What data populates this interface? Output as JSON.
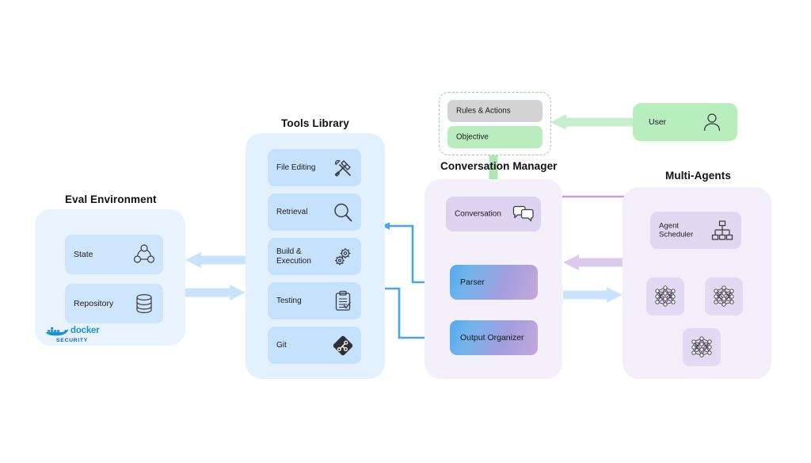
{
  "sections": {
    "eval_environment": {
      "title": "Eval Environment",
      "cards": [
        {
          "label": "State",
          "icon": "state-graph-icon"
        },
        {
          "label": "Repository",
          "icon": "database-icon"
        }
      ],
      "logo": {
        "name": "docker-security-logo",
        "word": "docker",
        "sub": "SECURITY"
      },
      "color": "#e8f3fd"
    },
    "tools_library": {
      "title": "Tools Library",
      "color": "#e3f0fd",
      "tools": [
        {
          "label": "File Editing",
          "icon": "hammer-wrench-icon"
        },
        {
          "label": "Retrieval",
          "icon": "magnifier-icon"
        },
        {
          "label": "Build & Execution",
          "icon": "gears-icon"
        },
        {
          "label": "Testing",
          "icon": "clipboard-checklist-icon"
        },
        {
          "label": "Git",
          "icon": "git-icon"
        }
      ]
    },
    "objective_group": {
      "cards": [
        {
          "label": "Rules & Actions",
          "color": "#d3d3d3"
        },
        {
          "label": "Objective",
          "color": "#b9ecbe"
        }
      ],
      "border_color": "#8fd79a"
    },
    "user": {
      "label": "User",
      "icon": "person-icon",
      "color": "#b8edbe"
    },
    "conversation_manager": {
      "title": "Conversation Manager",
      "color": "#f4f0fb",
      "conversation": {
        "label": "Conversation",
        "icon": "chat-bubbles-icon"
      },
      "parser": {
        "label": "Parser"
      },
      "output_organizer": {
        "label": "Output Organizer"
      }
    },
    "multi_agents": {
      "title": "Multi-Agents",
      "color": "#f2eefa",
      "scheduler": {
        "label": "Agent\nScheduler",
        "label_line1": "Agent",
        "label_line2": "Scheduler",
        "icon": "org-chart-icon"
      },
      "agents": [
        {
          "icon": "neural-network-icon"
        },
        {
          "icon": "neural-network-icon"
        },
        {
          "icon": "neural-network-icon"
        }
      ]
    }
  },
  "colors": {
    "blue_arrow": "#bfdffb",
    "purple_arrow": "#cdb6e4",
    "purple_arrow_light": "#dccaee",
    "green_arrow": "#c6efcd",
    "panel_blue": "#e8f3fd",
    "panel_purple": "#f4f0fb",
    "card_blue": "#c6e1fb",
    "icon_stroke": "#3b3b44"
  },
  "arrows": [
    {
      "name": "user-to-objective",
      "color": "#c6efcd",
      "from": "User",
      "to": "Rules & Actions"
    },
    {
      "name": "objective-to-conversation",
      "color": "#a9e5b4",
      "from": "Objective group",
      "to": "Conversation"
    },
    {
      "name": "eval-to-tools",
      "color": "#bfdffb",
      "from": "Tools Library",
      "to": "Eval Environment"
    },
    {
      "name": "tools-to-eval",
      "color": "#bfdffb",
      "from": "Eval Environment",
      "to": "Tools Library"
    },
    {
      "name": "parser-to-tools",
      "color": "#57aaf3",
      "from": "Parser",
      "to": "Tools Library"
    },
    {
      "name": "tools-to-output-organizer",
      "color": "#57aaf3",
      "from": "Tools Library",
      "to": "Output Organizer"
    },
    {
      "name": "conversation-to-scheduler",
      "color": "#c0a4dd",
      "from": "Conversation",
      "to": "Agent Scheduler"
    },
    {
      "name": "output-organizer-to-conversation",
      "color": "#c0a4dd",
      "from": "Output Organizer",
      "to": "Conversation"
    },
    {
      "name": "agents-to-conversation-manager",
      "color": "#dccaee",
      "from": "Multi-Agents",
      "to": "Conversation Manager"
    },
    {
      "name": "conversation-manager-to-agents",
      "color": "#bfdffb",
      "from": "Conversation Manager",
      "to": "Multi-Agents"
    },
    {
      "name": "parser-to-output-organizer",
      "color": "#b79ad6",
      "from": "Parser",
      "to": "Output Organizer"
    },
    {
      "name": "agent-nodes-to-scheduler",
      "color": "#ded2ef",
      "from": "Agent nodes",
      "to": "Agent Scheduler"
    }
  ]
}
